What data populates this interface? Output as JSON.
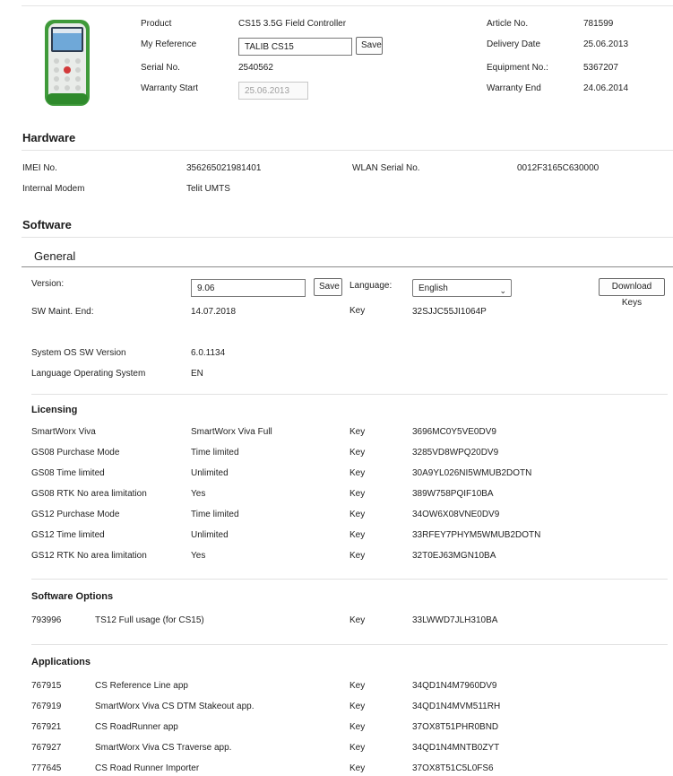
{
  "product": {
    "product_label": "Product",
    "product_value": "CS15 3.5G Field Controller",
    "reference_label": "My Reference",
    "reference_value": "TALIB CS15",
    "save_label": "Save",
    "serial_label": "Serial No.",
    "serial_value": "2540562",
    "warranty_start_label": "Warranty Start",
    "warranty_start_value": "25.06.2013",
    "article_label": "Article No.",
    "article_value": "781599",
    "delivery_label": "Delivery Date",
    "delivery_value": "25.06.2013",
    "equipment_label": "Equipment No.:",
    "equipment_value": "5367207",
    "warranty_end_label": "Warranty End",
    "warranty_end_value": "24.06.2014"
  },
  "hardware": {
    "title": "Hardware",
    "imei_label": "IMEI No.",
    "imei_value": "356265021981401",
    "wlan_label": "WLAN Serial No.",
    "wlan_value": "0012F3165C630000",
    "modem_label": "Internal Modem",
    "modem_value": "Telit UMTS"
  },
  "software": {
    "title": "Software",
    "general": {
      "title": "General",
      "version_label": "Version:",
      "version_value": "9.06",
      "save_label": "Save",
      "language_label": "Language:",
      "language_value": "English",
      "download_keys_label": "Download Keys",
      "sw_maint_label": "SW Maint. End:",
      "sw_maint_value": "14.07.2018",
      "key_label": "Key",
      "key_value": "32SJJC55JI1064P",
      "os_label": "System OS SW Version",
      "os_value": "6.0.1134",
      "lang_os_label": "Language Operating System",
      "lang_os_value": "EN"
    },
    "licensing": {
      "title": "Licensing",
      "rows": [
        {
          "name": "SmartWorx Viva",
          "value": "SmartWorx Viva Full",
          "key_label": "Key",
          "key": "3696MC0Y5VE0DV9"
        },
        {
          "name": "GS08 Purchase Mode",
          "value": "Time limited",
          "key_label": "Key",
          "key": "3285VD8WPQ20DV9"
        },
        {
          "name": "GS08 Time limited",
          "value": "Unlimited",
          "key_label": "Key",
          "key": "30A9YL026NI5WMUB2DOTN"
        },
        {
          "name": "GS08 RTK No area limitation",
          "value": "Yes",
          "key_label": "Key",
          "key": "389W758PQIF10BA"
        },
        {
          "name": "GS12 Purchase Mode",
          "value": "Time limited",
          "key_label": "Key",
          "key": "34OW6X08VNE0DV9"
        },
        {
          "name": "GS12 Time limited",
          "value": "Unlimited",
          "key_label": "Key",
          "key": "33RFEY7PHYM5WMUB2DOTN"
        },
        {
          "name": "GS12 RTK No area limitation",
          "value": "Yes",
          "key_label": "Key",
          "key": "32T0EJ63MGN10BA"
        }
      ]
    },
    "options": {
      "title": "Software Options",
      "rows": [
        {
          "id": "793996",
          "name": "TS12 Full usage (for CS15)",
          "key_label": "Key",
          "key": "33LWWD7JLH310BA"
        }
      ]
    },
    "applications": {
      "title": "Applications",
      "rows": [
        {
          "id": "767915",
          "name": "CS Reference Line app",
          "key_label": "Key",
          "key": "34QD1N4M7960DV9"
        },
        {
          "id": "767919",
          "name": "SmartWorx Viva CS DTM Stakeout app.",
          "key_label": "Key",
          "key": "34QD1N4MVM511RH"
        },
        {
          "id": "767921",
          "name": "CS RoadRunner app",
          "key_label": "Key",
          "key": "37OX8T51PHR0BND"
        },
        {
          "id": "767927",
          "name": "SmartWorx Viva CS Traverse app.",
          "key_label": "Key",
          "key": "34QD1N4MNTB0ZYT"
        },
        {
          "id": "777645",
          "name": "CS Road Runner Importer",
          "key_label": "Key",
          "key": "37OX8T51C5L0FS6"
        }
      ]
    }
  }
}
